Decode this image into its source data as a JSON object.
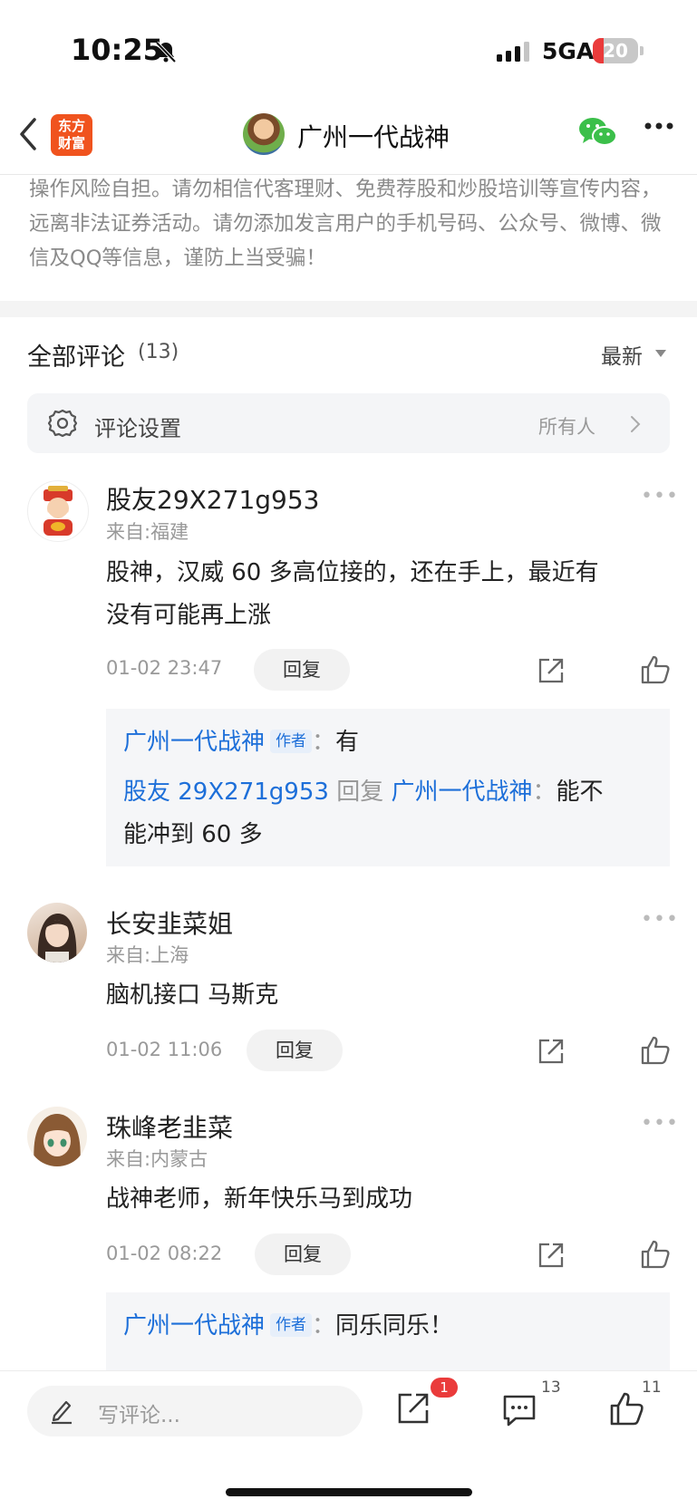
{
  "status_bar": {
    "time": "10:25",
    "network": "5GA",
    "battery": "20"
  },
  "nav": {
    "app_logo_line1": "东方",
    "app_logo_line2": "财富",
    "title": "广州一代战神"
  },
  "disclaimer": "操作风险自担。请勿相信代客理财、免费荐股和炒股培训等宣传内容，远离非法证券活动。请勿添加发言用户的手机号码、公众号、微博、微信及QQ等信息，谨防上当受骗！",
  "comments_header": {
    "title": "全部评论",
    "count": "(13)",
    "sort": "最新"
  },
  "settings": {
    "label": "评论设置",
    "value": "所有人"
  },
  "comments": [
    {
      "username": "股友29X271g953",
      "location": "来自:福建",
      "text_line1": "股神，汉威 60 多高位接的，还在手上，最近有",
      "text_line2": "没有可能再上涨",
      "time": "01-02 23:47",
      "reply_label": "回复",
      "replies": [
        {
          "author": "广州一代战神",
          "tag": "作者",
          "colon": "：",
          "text": "有"
        },
        {
          "author": "股友 29X271g953",
          "reply_word": "回复",
          "target": "广州一代战神",
          "colon": "：",
          "text_part1": "能不",
          "text_part2": "能冲到 60 多"
        }
      ]
    },
    {
      "username": "长安韭菜姐",
      "location": "来自:上海",
      "text_line1": "脑机接口 马斯克",
      "time": "01-02 11:06",
      "reply_label": "回复"
    },
    {
      "username": "珠峰老韭菜",
      "location": "来自:内蒙古",
      "text_line1": "战神老师，新年快乐马到成功",
      "time": "01-02 08:22",
      "reply_label": "回复",
      "replies": [
        {
          "author": "广州一代战神",
          "tag": "作者",
          "colon": "：",
          "text": "同乐同乐！"
        }
      ]
    }
  ],
  "bottom_bar": {
    "placeholder": "写评论...",
    "share_badge": "1",
    "comment_count": "13",
    "like_count": "11"
  }
}
